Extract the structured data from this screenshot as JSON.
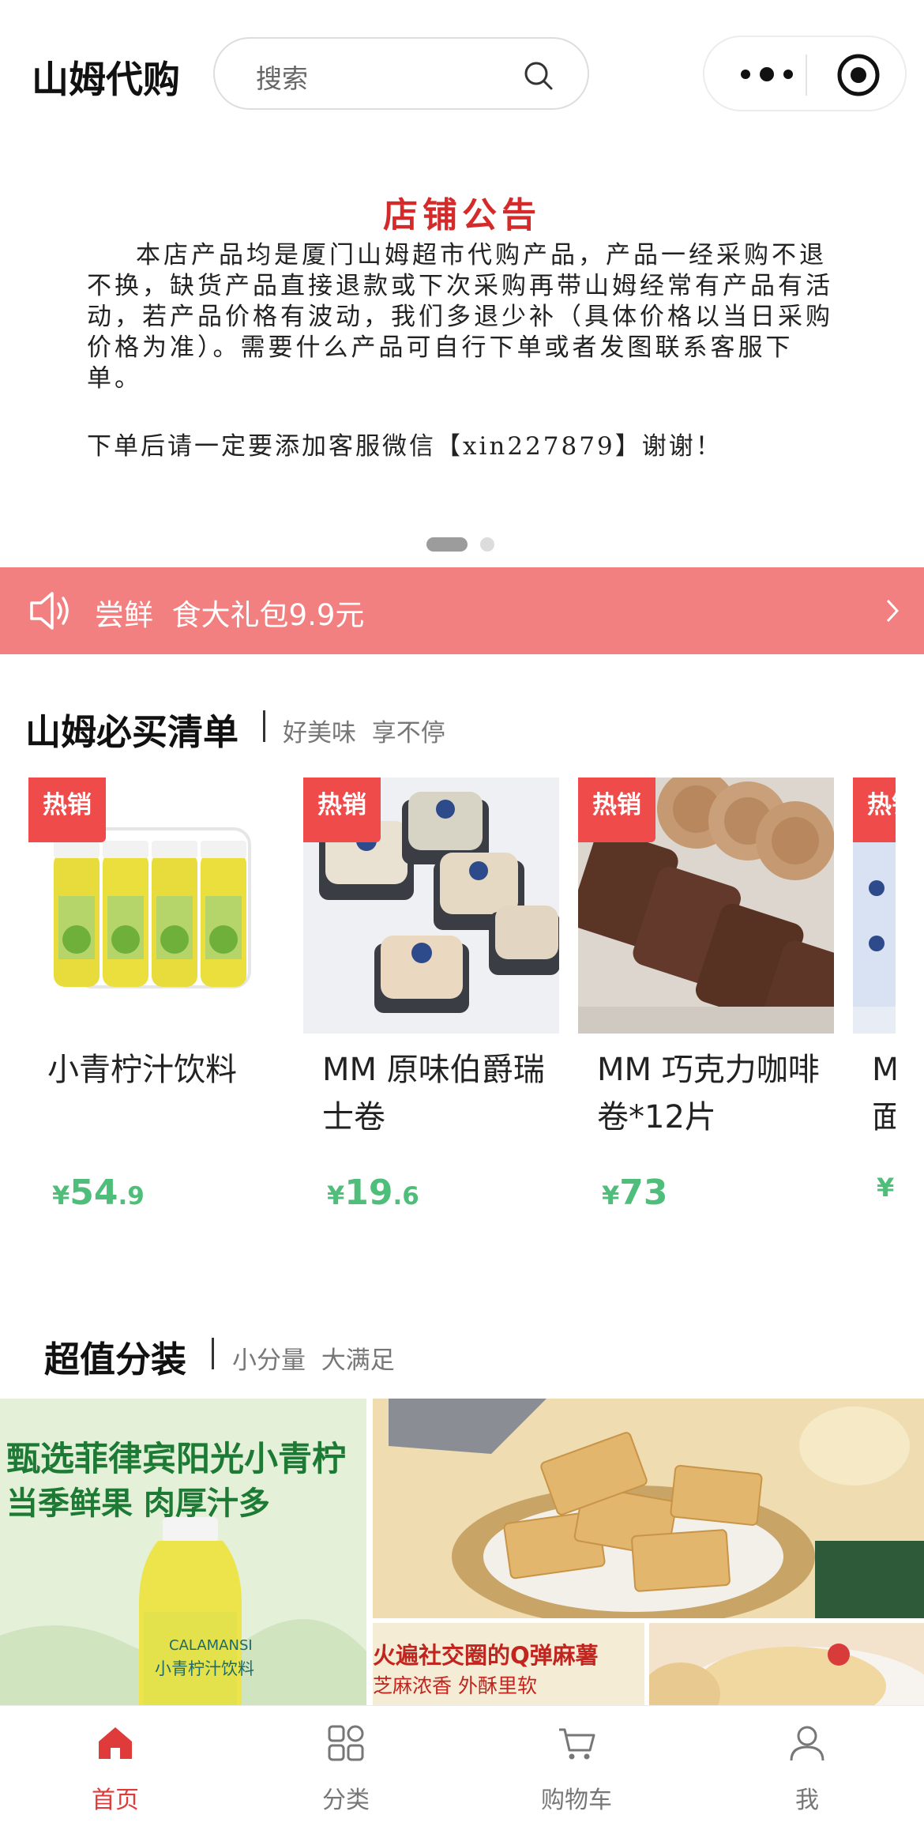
{
  "header": {
    "app_title": "山姆代购",
    "search_placeholder": "搜索",
    "icons": [
      "search-icon",
      "more-icon",
      "target-icon"
    ]
  },
  "banner": {
    "notice_title": "店铺公告",
    "notice_body": "本店产品均是厦门山姆超市代购产品，产品一经采购不退不换，缺货产品直接退款或下次采购再带山姆经常有产品有活动，若产品价格有波动，我们多退少补（具体价格以当日采购价格为准）。需要什么产品可自行下单或者发图联系客服下单。",
    "notice_footer": "下单后请一定要添加客服微信【xin227879】谢谢！",
    "slide_count": 2,
    "active_slide": 1
  },
  "promo": {
    "text": "尝鲜  食大礼包9.9元"
  },
  "section_must_buy": {
    "title": "山姆必买清单",
    "subtitle": "好美味  享不停",
    "products": [
      {
        "badge": "热销",
        "name": "小青柠汁饮料",
        "price_currency": "¥",
        "price_int": "54",
        "price_dec": ".9"
      },
      {
        "badge": "热销",
        "name": "MM 原味伯爵瑞士卷",
        "price_currency": "¥",
        "price_int": "19",
        "price_dec": ".6"
      },
      {
        "badge": "热销",
        "name": "MM 巧克力咖啡卷*12片",
        "price_currency": "¥",
        "price_int": "73",
        "price_dec": ""
      },
      {
        "badge": "热销",
        "name": "M\n面",
        "price_currency": "¥",
        "price_int": "",
        "price_dec": ""
      }
    ]
  },
  "section_value_pack": {
    "title": "超值分装",
    "subtitle": "小分量  大满足",
    "tiles": [
      {
        "line1": "甄选菲律宾阳光小青柠",
        "line2": "当季鲜果 肉厚汁多",
        "bottle_brand": "CALAMANSI",
        "bottle_label": "小青柠汁饮料"
      },
      {
        "caption": ""
      },
      {
        "line1": "火遍社交圈的Q弹麻薯",
        "line2": "芝麻浓香 外酥里软"
      },
      {
        "caption": ""
      }
    ]
  },
  "tabbar": {
    "tabs": [
      {
        "label": "首页",
        "icon": "home-icon",
        "active": true
      },
      {
        "label": "分类",
        "icon": "category-icon",
        "active": false
      },
      {
        "label": "购物车",
        "icon": "cart-icon",
        "active": false
      },
      {
        "label": "我",
        "icon": "user-icon",
        "active": false
      }
    ]
  },
  "colors": {
    "brand_red": "#ef4b4b",
    "promo_bg": "#f28080",
    "price_green": "#4fbe7a",
    "notice_red": "#d42a2a"
  }
}
